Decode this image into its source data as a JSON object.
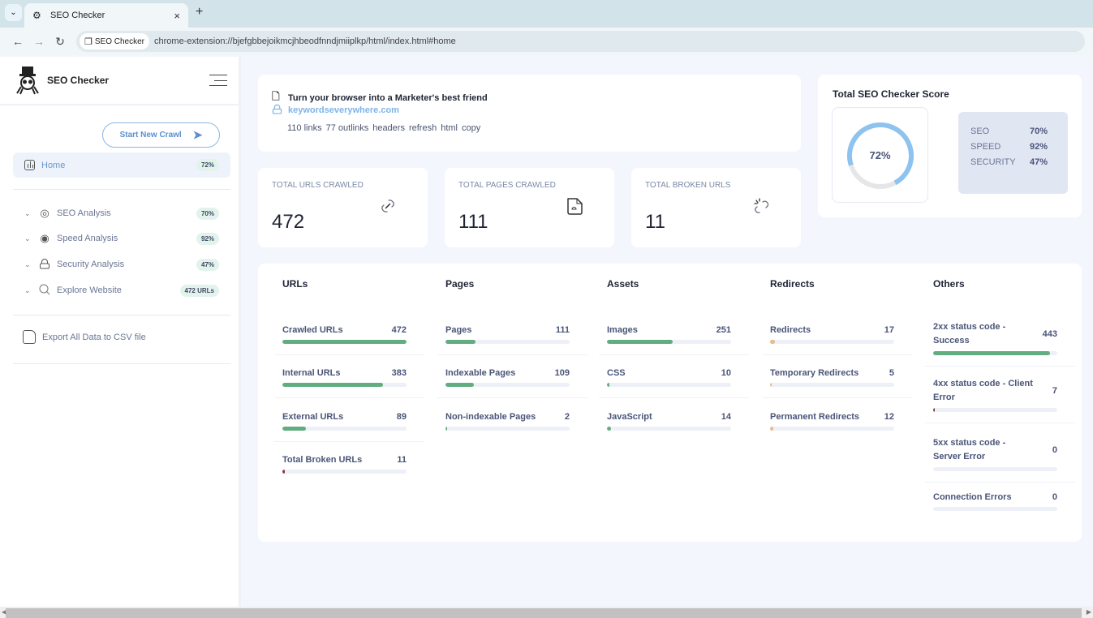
{
  "browser": {
    "tab_title": "SEO Checker",
    "tab_close": "×",
    "new_tab": "+",
    "site_chip": "SEO Checker",
    "url": "chrome-extension://bjefgbbejoikmcjhbeodfnndjmiiplkp/html/index.html#home"
  },
  "sidebar": {
    "brand": "SEO Checker",
    "crawl_button": "Start New Crawl",
    "home": {
      "label": "Home",
      "badge": "72%"
    },
    "items": [
      {
        "label": "SEO Analysis",
        "badge": "70%",
        "icon": "target-icon"
      },
      {
        "label": "Speed Analysis",
        "badge": "92%",
        "icon": "speed-icon"
      },
      {
        "label": "Security Analysis",
        "badge": "47%",
        "icon": "lock-icon"
      },
      {
        "label": "Explore Website",
        "badge": "472 URLs",
        "icon": "search-icon"
      }
    ],
    "export": "Export All Data to CSV file"
  },
  "info": {
    "title": "Turn your browser into a Marketer's best friend",
    "domain": "keywordseverywhere.com",
    "links": [
      "110 links",
      "77 outlinks",
      "headers",
      "refresh",
      "html",
      "copy"
    ]
  },
  "score": {
    "title": "Total SEO Checker Score",
    "total": 72,
    "total_label": "72%",
    "breakdown": [
      {
        "label": "SEO",
        "value": "70%"
      },
      {
        "label": "SPEED",
        "value": "92%"
      },
      {
        "label": "SECURITY",
        "value": "47%"
      }
    ],
    "colors": {
      "ring": "#8ec3ef",
      "track": "#e6e6e9"
    }
  },
  "stats": [
    {
      "label": "TOTAL URLS CRAWLED",
      "value": "472",
      "icon": "link-icon"
    },
    {
      "label": "TOTAL PAGES CRAWLED",
      "value": "111",
      "icon": "page-icon"
    },
    {
      "label": "TOTAL BROKEN URLS",
      "value": "11",
      "icon": "broken-link-icon"
    }
  ],
  "metrics": {
    "colors": {
      "green": "#62ad80",
      "red": "#8b3a3a",
      "orange": "#e8b98a"
    },
    "columns": [
      {
        "title": "URLs",
        "items": [
          {
            "label": "Crawled URLs",
            "value": "472",
            "pct": 100,
            "color": "green"
          },
          {
            "label": "Internal URLs",
            "value": "383",
            "pct": 81,
            "color": "green"
          },
          {
            "label": "External URLs",
            "value": "89",
            "pct": 19,
            "color": "green"
          },
          {
            "label": "Total Broken URLs",
            "value": "11",
            "pct": 2,
            "color": "red"
          }
        ]
      },
      {
        "title": "Pages",
        "items": [
          {
            "label": "Pages",
            "value": "111",
            "pct": 24,
            "color": "green"
          },
          {
            "label": "Indexable Pages",
            "value": "109",
            "pct": 23,
            "color": "green"
          },
          {
            "label": "Non-indexable Pages",
            "value": "2",
            "pct": 0.5,
            "color": "green"
          }
        ]
      },
      {
        "title": "Assets",
        "items": [
          {
            "label": "Images",
            "value": "251",
            "pct": 53,
            "color": "green"
          },
          {
            "label": "CSS",
            "value": "10",
            "pct": 2,
            "color": "green"
          },
          {
            "label": "JavaScript",
            "value": "14",
            "pct": 3,
            "color": "green"
          }
        ]
      },
      {
        "title": "Redirects",
        "items": [
          {
            "label": "Redirects",
            "value": "17",
            "pct": 3.6,
            "color": "orange"
          },
          {
            "label": "Temporary Redirects",
            "value": "5",
            "pct": 1,
            "color": "orange"
          },
          {
            "label": "Permanent Redirects",
            "value": "12",
            "pct": 2.5,
            "color": "orange"
          }
        ]
      },
      {
        "title": "Others",
        "items": [
          {
            "label": "2xx status code - Success",
            "value": "443",
            "pct": 94,
            "color": "green"
          },
          {
            "label": "4xx status code - Client Error",
            "value": "7",
            "pct": 1.5,
            "color": "red"
          },
          {
            "label": "5xx status code - Server Error",
            "value": "0",
            "pct": 0,
            "color": "red"
          },
          {
            "label": "Connection Errors",
            "value": "0",
            "pct": 0,
            "color": "red"
          }
        ]
      }
    ]
  }
}
